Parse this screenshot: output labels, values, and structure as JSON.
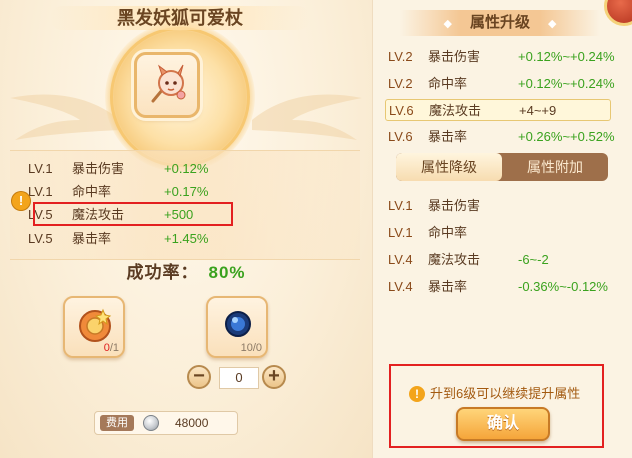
{
  "item": {
    "name": "黑发妖狐可爱杖"
  },
  "current_stats": [
    {
      "level": "LV.1",
      "name": "暴击伤害",
      "value": "+0.12%"
    },
    {
      "level": "LV.1",
      "name": "命中率",
      "value": "+0.17%"
    },
    {
      "level": "LV.5",
      "name": "魔法攻击",
      "value": "+500"
    },
    {
      "level": "LV.5",
      "name": "暴击率",
      "value": "+1.45%"
    }
  ],
  "success_rate": {
    "label": "成功率：",
    "value": "80%"
  },
  "materials": [
    {
      "icon": "talisman-icon",
      "count_have": "0",
      "count_need": "/1"
    },
    {
      "icon": "blue-orb-icon",
      "count": "10/0"
    }
  ],
  "stepper": {
    "value": "0",
    "minus": "−",
    "plus": "+"
  },
  "cost": {
    "label": "费用",
    "icon": "silver-coin-icon",
    "value": "48000"
  },
  "upgrade_panel": {
    "title": "属性升级",
    "stars": "◆",
    "rows": [
      {
        "level": "LV.2",
        "name": "暴击伤害",
        "value": "+0.12%~+0.24%"
      },
      {
        "level": "LV.2",
        "name": "命中率",
        "value": "+0.12%~+0.24%"
      },
      {
        "level": "LV.6",
        "name": "魔法攻击",
        "value": "+4~+9",
        "selected": true
      },
      {
        "level": "LV.6",
        "name": "暴击率",
        "value": "+0.26%~+0.52%"
      }
    ]
  },
  "tabs": [
    {
      "label": "属性降级",
      "active": true
    },
    {
      "label": "属性附加",
      "active": false
    }
  ],
  "downgrade_rows": [
    {
      "level": "LV.1",
      "name": "暴击伤害",
      "value": ""
    },
    {
      "level": "LV.1",
      "name": "命中率",
      "value": ""
    },
    {
      "level": "LV.4",
      "name": "魔法攻击",
      "value": "-6~-2"
    },
    {
      "level": "LV.4",
      "name": "暴击率",
      "value": "-0.36%~-0.12%"
    }
  ],
  "notice": {
    "text": "升到6级可以继续提升属性",
    "icon": "warning-icon"
  },
  "confirm_button": {
    "label": "确认"
  },
  "warning_mark": "!",
  "colors": {
    "positive": "#3aa21e",
    "highlight": "#e32020",
    "level": "#8a4a1a",
    "accent": "#f5a53a"
  }
}
